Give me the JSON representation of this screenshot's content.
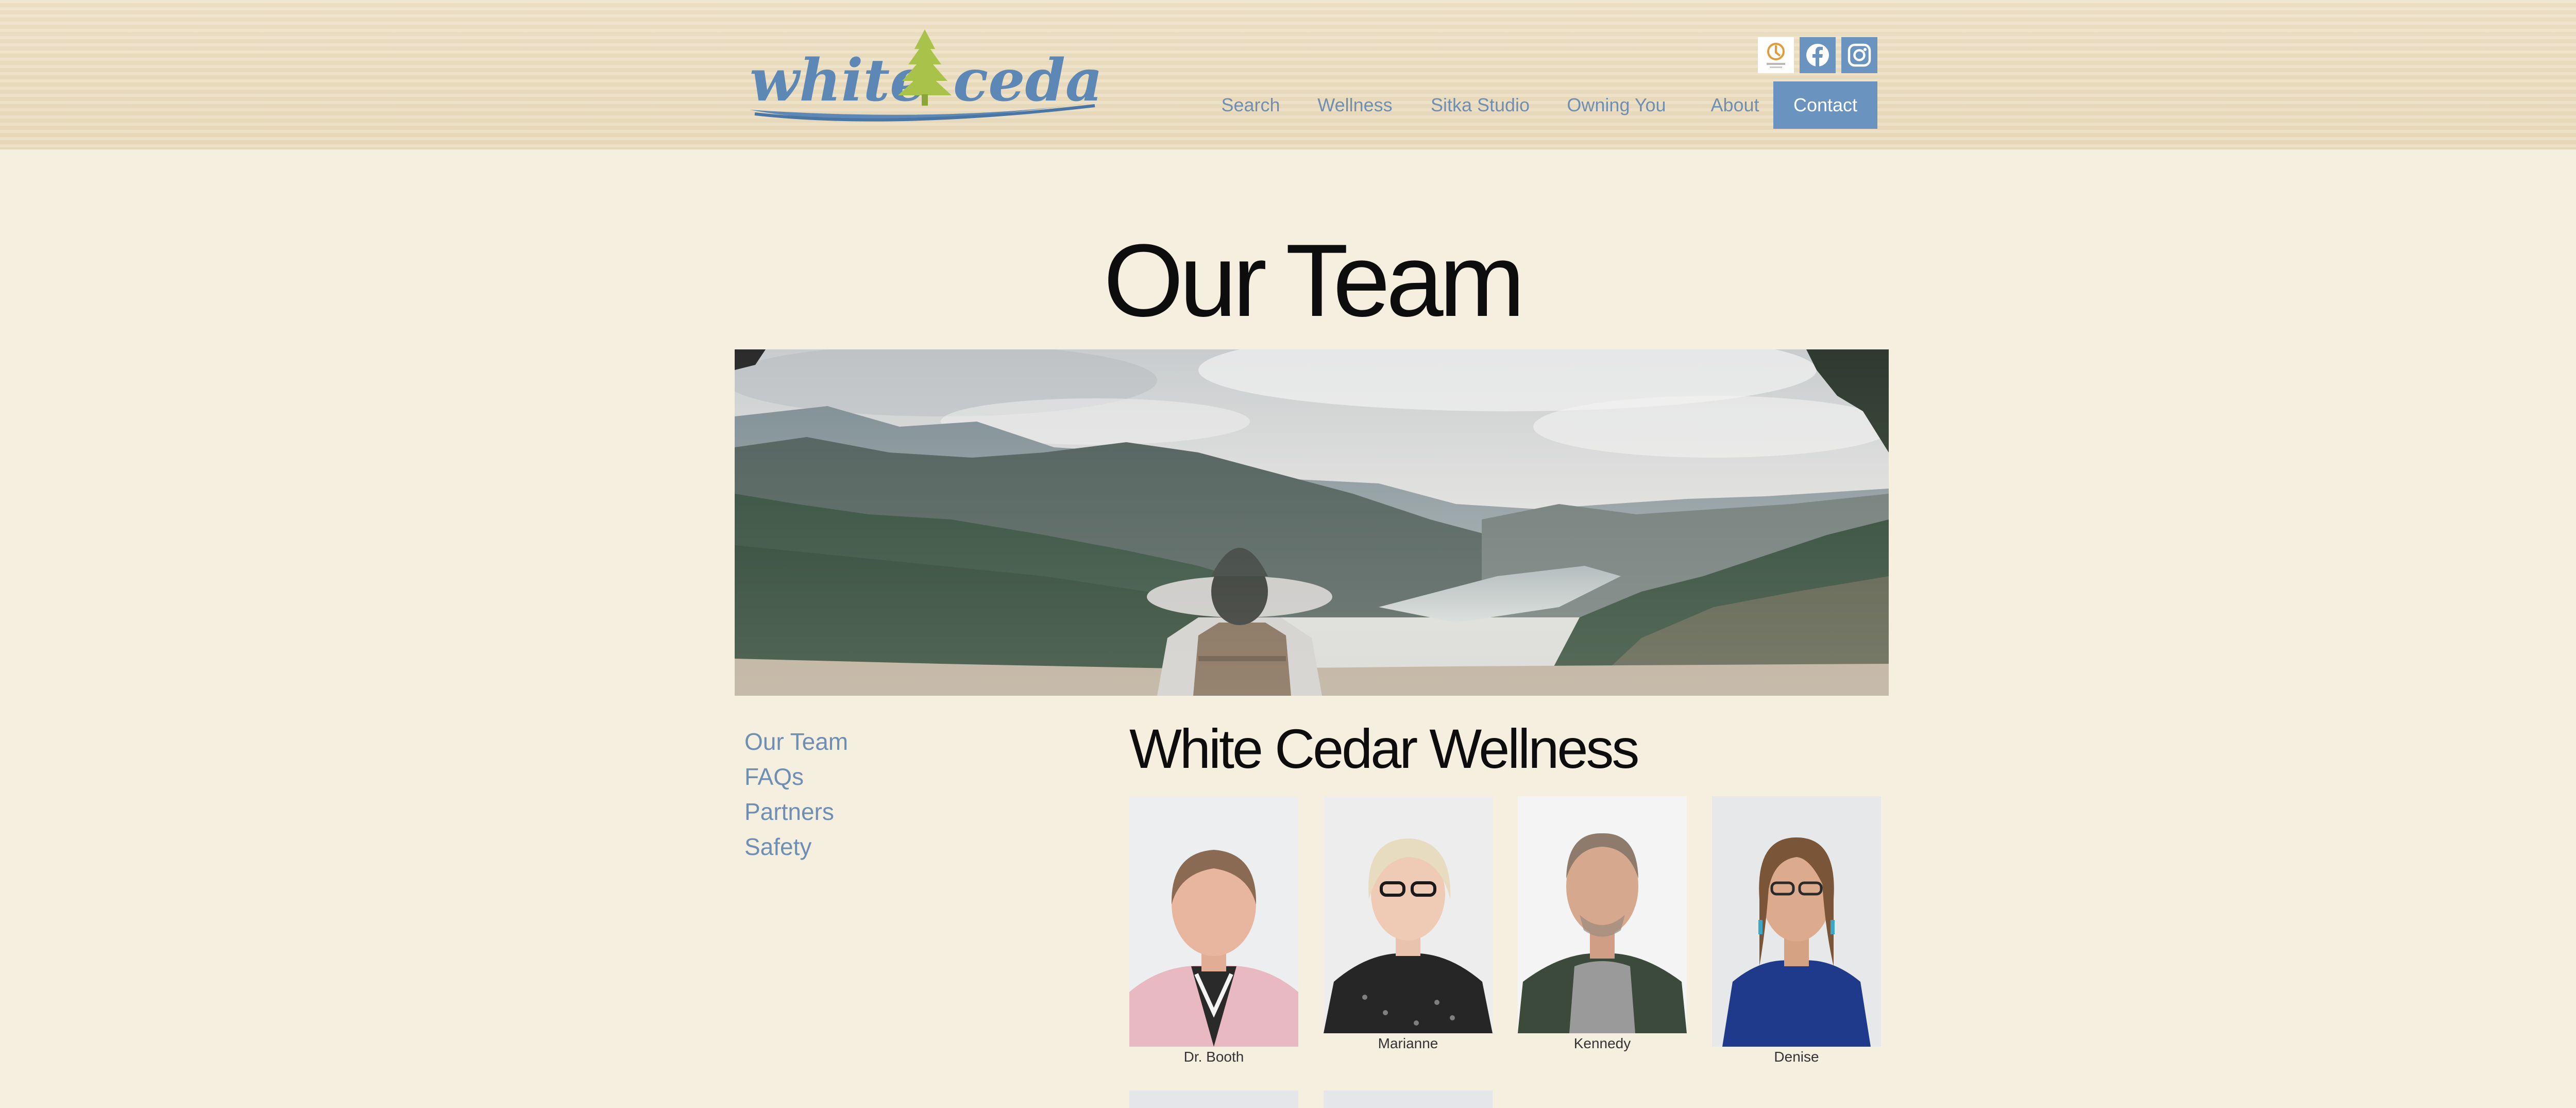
{
  "brand": {
    "logo_text": "white cedar"
  },
  "header_icons": [
    {
      "name": "seal-icon",
      "label": ""
    },
    {
      "name": "facebook-icon"
    },
    {
      "name": "instagram-icon"
    }
  ],
  "nav": {
    "items": [
      "Search",
      "Wellness",
      "Sitka Studio",
      "Owning You",
      "About"
    ],
    "contact": "Contact"
  },
  "page": {
    "title": "Our Team"
  },
  "sidebar": {
    "links": [
      "Our Team",
      "FAQs",
      "Partners",
      "Safety"
    ]
  },
  "section": {
    "title": "White Cedar Wellness"
  },
  "team": [
    {
      "name": "Dr. Booth"
    },
    {
      "name": "Marianne"
    },
    {
      "name": "Kennedy"
    },
    {
      "name": "Denise"
    }
  ],
  "colors": {
    "accent": "#6a93c0",
    "link": "#6e8fb3",
    "background": "#f5efe0"
  }
}
